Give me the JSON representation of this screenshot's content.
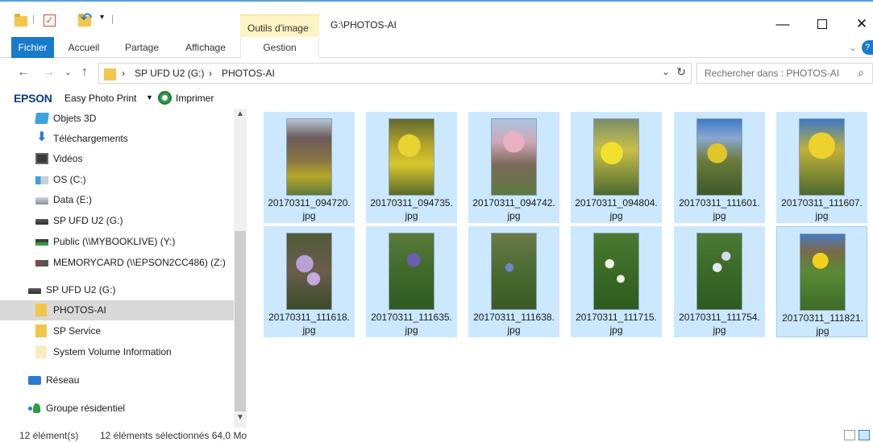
{
  "window": {
    "tool_tab_label": "Outils d'image",
    "path_title": "G:\\PHOTOS-AI",
    "controls": {
      "minimize": "—",
      "close": "✕"
    }
  },
  "quick_access": {
    "dropdown": "▾"
  },
  "ribbon": {
    "tabs": [
      {
        "label": "Fichier"
      },
      {
        "label": "Accueil"
      },
      {
        "label": "Partage"
      },
      {
        "label": "Affichage"
      },
      {
        "label": "Gestion"
      }
    ],
    "collapse": "⌄",
    "help": "?"
  },
  "address": {
    "back": "←",
    "forward": "→",
    "recent": "⌄",
    "up": "↑",
    "crumbs": [
      "›",
      "SP UFD U2 (G:)",
      "›",
      "PHOTOS-AI"
    ],
    "dropdown": "⌄",
    "refresh": "↻"
  },
  "search": {
    "placeholder": "Rechercher dans : PHOTOS-AI",
    "icon": "⌕"
  },
  "epson": {
    "logo": "EPSON",
    "app": "Easy Photo Print",
    "dropdown": "▼",
    "print_label": "Imprimer"
  },
  "nav": {
    "items": [
      {
        "label": "Objets 3D",
        "icon": "3d-objects-icon"
      },
      {
        "label": "Téléchargements",
        "icon": "downloads-icon"
      },
      {
        "label": "Vidéos",
        "icon": "videos-icon"
      },
      {
        "label": "OS (C:)",
        "icon": "windows-drive-icon"
      },
      {
        "label": "Data (E:)",
        "icon": "drive-icon"
      },
      {
        "label": "SP UFD U2 (G:)",
        "icon": "usb-drive-icon"
      },
      {
        "label": "Public (\\\\MYBOOKLIVE) (Y:)",
        "icon": "network-drive-icon"
      },
      {
        "label": "MEMORYCARD (\\\\EPSON2CC486) (Z:)",
        "icon": "disconnected-network-drive-icon"
      },
      {
        "label": "SP UFD U2 (G:)",
        "icon": "usb-drive-icon"
      },
      {
        "label": "PHOTOS-AI",
        "icon": "folder-icon",
        "selected": true
      },
      {
        "label": "SP Service",
        "icon": "folder-icon"
      },
      {
        "label": "System Volume Information",
        "icon": "folder-icon"
      },
      {
        "label": "Réseau",
        "icon": "network-icon"
      },
      {
        "label": "Groupe résidentiel",
        "icon": "homegroup-icon"
      }
    ],
    "scroll_up": "▲",
    "scroll_down": "▼"
  },
  "files": [
    {
      "line1": "20170311_094720.",
      "line2": "jpg",
      "theme": "bare tree with yellow bushes"
    },
    {
      "line1": "20170311_094735.",
      "line2": "jpg",
      "theme": "yellow forsythia"
    },
    {
      "line1": "20170311_094742.",
      "line2": "jpg",
      "theme": "pink blossom tree"
    },
    {
      "line1": "20170311_094804.",
      "line2": "jpg",
      "theme": "yellow mahonia"
    },
    {
      "line1": "20170311_111601.",
      "line2": "jpg",
      "theme": "yellow bush under blue sky"
    },
    {
      "line1": "20170311_111607.",
      "line2": "jpg",
      "theme": "yellow flowers blue sky"
    },
    {
      "line1": "20170311_111618.",
      "line2": "jpg",
      "theme": "lilac crocus"
    },
    {
      "line1": "20170311_111635.",
      "line2": "jpg",
      "theme": "grape hyacinth"
    },
    {
      "line1": "20170311_111638.",
      "line2": "jpg",
      "theme": "blue wildflowers"
    },
    {
      "line1": "20170311_111715.",
      "line2": "jpg",
      "theme": "white flowers in grass"
    },
    {
      "line1": "20170311_111754.",
      "line2": "jpg",
      "theme": "white flowers ground cover"
    },
    {
      "line1": "20170311_111821.",
      "line2": "jpg",
      "theme": "yellow daffodil"
    }
  ],
  "status": {
    "count": "12 élément(s)",
    "selection": "12 éléments sélectionnés  64,0 Mo"
  },
  "colors": {
    "accent": "#1979ca",
    "selection": "#cce8ff",
    "tool_tab": "#fff4c4"
  }
}
